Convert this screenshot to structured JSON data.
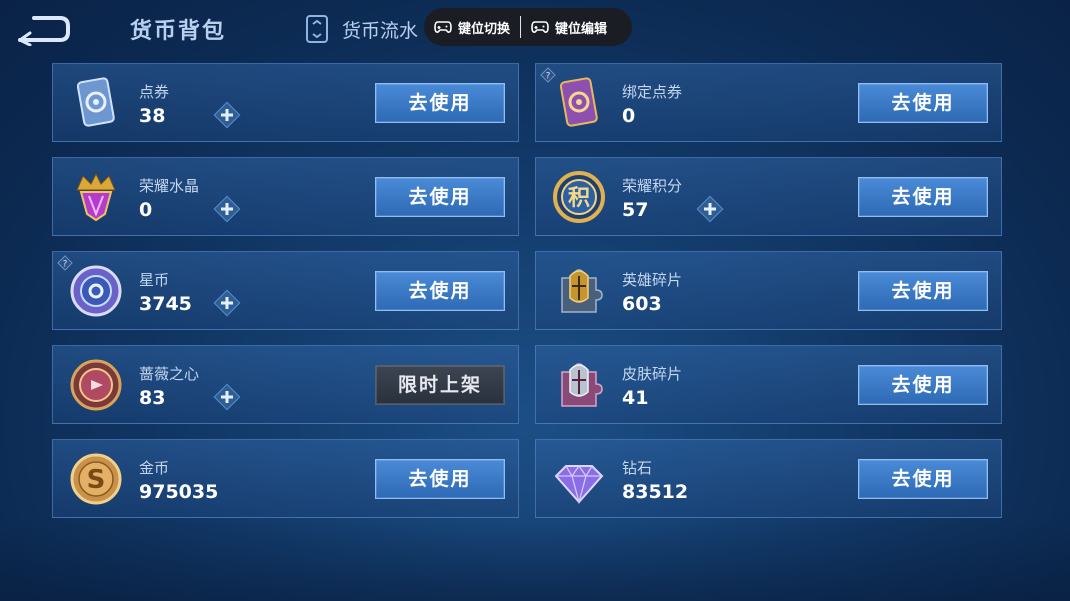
{
  "header": {
    "title": "货币背包",
    "flow_label": "货币流水",
    "key_switch_label": "键位切换",
    "key_edit_label": "键位编辑"
  },
  "currencies": [
    {
      "name": "点券",
      "value": "38",
      "button": "去使用",
      "icon": "voucher-card-icon"
    },
    {
      "name": "绑定点券",
      "value": "0",
      "button": "去使用",
      "icon": "bound-voucher-card-icon"
    },
    {
      "name": "荣耀水晶",
      "value": "0",
      "button": "去使用",
      "icon": "glory-crystal-icon"
    },
    {
      "name": "荣耀积分",
      "value": "57",
      "button": "去使用",
      "icon": "glory-points-icon"
    },
    {
      "name": "星币",
      "value": "3745",
      "button": "去使用",
      "icon": "star-coin-icon"
    },
    {
      "name": "英雄碎片",
      "value": "603",
      "button": "去使用",
      "icon": "hero-fragment-icon"
    },
    {
      "name": "蔷薇之心",
      "value": "83",
      "button": "限时上架",
      "icon": "rose-heart-icon"
    },
    {
      "name": "皮肤碎片",
      "value": "41",
      "button": "去使用",
      "icon": "skin-fragment-icon"
    },
    {
      "name": "金币",
      "value": "975035",
      "button": "去使用",
      "icon": "gold-coin-icon"
    },
    {
      "name": "钻石",
      "value": "83512",
      "button": "去使用",
      "icon": "diamond-icon"
    }
  ],
  "colors": {
    "accent_button": "#3a78c6",
    "disabled_button": "#343b47",
    "background": "#123a6a"
  }
}
